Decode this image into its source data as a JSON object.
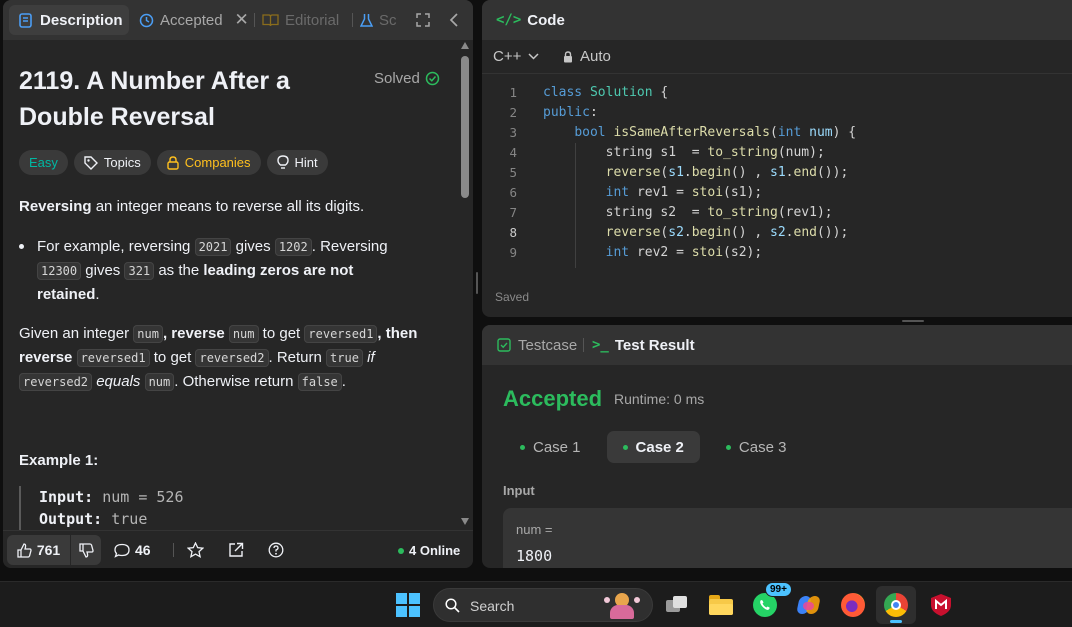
{
  "left_tabs": {
    "description": "Description",
    "accepted": "Accepted",
    "editorial": "Editorial",
    "solutions": "Sc"
  },
  "problem": {
    "title_line1": "2119. A Number After a",
    "title_line2": "Double Reversal",
    "solved": "Solved",
    "tags": {
      "easy": "Easy",
      "topics": "Topics",
      "companies": "Companies",
      "hint": "Hint"
    },
    "p1_bold": "Reversing",
    "p1_rest": " an integer means to reverse all its digits.",
    "bullet": {
      "t1": "For example, reversing ",
      "c1": "2021",
      "t2": " gives ",
      "c2": "1202",
      "t3": ". Reversing",
      "c3": "12300",
      "t4": " gives ",
      "c4": "321",
      "t5": " as the ",
      "b1": "leading zeros are not",
      "b2": "retained",
      "t6": "."
    },
    "p2": {
      "t1": "Given an integer ",
      "c1": "num",
      "b1": ", reverse ",
      "c2": "num",
      "t2": " to get ",
      "c3": "reversed1",
      "b2": ", then",
      "b3": "reverse ",
      "c4": "reversed1",
      "t3": " to get ",
      "c5": "reversed2",
      "t4": ". Return ",
      "c6": "true",
      "i1": " if",
      "c7": "reversed2",
      "i2": " equals ",
      "c8": "num",
      "t5": ". Otherwise return ",
      "c9": "false",
      "t6": "."
    },
    "example_title": "Example 1:",
    "ex_input_label": "Input:",
    "ex_input_value": " num = 526",
    "ex_output_label": "Output:",
    "ex_output_value": " true"
  },
  "footer": {
    "likes": "761",
    "comments": "46",
    "online": "4 Online"
  },
  "code": {
    "title": "Code",
    "language": "C++",
    "auto": "Auto",
    "saved": "Saved",
    "lines": [
      {
        "n": "1",
        "tokens": [
          [
            "kw",
            "class "
          ],
          [
            "ty",
            "Solution"
          ],
          [
            "pl",
            " {"
          ]
        ]
      },
      {
        "n": "2",
        "tokens": [
          [
            "kw",
            "public"
          ],
          [
            "pl",
            ":"
          ]
        ]
      },
      {
        "n": "3",
        "tokens": [
          [
            "pl",
            "    "
          ],
          [
            "kw",
            "bool "
          ],
          [
            "fn",
            "isSameAfterReversals"
          ],
          [
            "pl",
            "("
          ],
          [
            "kw",
            "int "
          ],
          [
            "var",
            "num"
          ],
          [
            "pl",
            ") {"
          ]
        ]
      },
      {
        "n": "4",
        "tokens": [
          [
            "pl",
            "        string s1  = "
          ],
          [
            "fn",
            "to_string"
          ],
          [
            "pl",
            "(num);"
          ]
        ]
      },
      {
        "n": "5",
        "tokens": [
          [
            "pl",
            "        "
          ],
          [
            "fn",
            "reverse"
          ],
          [
            "pl",
            "("
          ],
          [
            "var",
            "s1"
          ],
          [
            "pl",
            "."
          ],
          [
            "fn",
            "begin"
          ],
          [
            "pl",
            "() , "
          ],
          [
            "var",
            "s1"
          ],
          [
            "pl",
            "."
          ],
          [
            "fn",
            "end"
          ],
          [
            "pl",
            "());"
          ]
        ]
      },
      {
        "n": "6",
        "tokens": [
          [
            "pl",
            "        "
          ],
          [
            "kw",
            "int "
          ],
          [
            "pl",
            "rev1 = "
          ],
          [
            "fn",
            "stoi"
          ],
          [
            "pl",
            "(s1);"
          ]
        ]
      },
      {
        "n": "7",
        "tokens": [
          [
            "pl",
            "        string s2  = "
          ],
          [
            "fn",
            "to_string"
          ],
          [
            "pl",
            "(rev1);"
          ]
        ]
      },
      {
        "n": "8",
        "tokens": [
          [
            "pl",
            "        "
          ],
          [
            "fn",
            "reverse"
          ],
          [
            "pl",
            "("
          ],
          [
            "var",
            "s2"
          ],
          [
            "pl",
            "."
          ],
          [
            "fn",
            "begin"
          ],
          [
            "pl",
            "() , "
          ],
          [
            "var",
            "s2"
          ],
          [
            "pl",
            "."
          ],
          [
            "fn",
            "end"
          ],
          [
            "pl",
            "());"
          ]
        ]
      },
      {
        "n": "9",
        "tokens": [
          [
            "pl",
            "        "
          ],
          [
            "kw",
            "int "
          ],
          [
            "pl",
            "rev2 = "
          ],
          [
            "fn",
            "stoi"
          ],
          [
            "pl",
            "(s2);"
          ]
        ]
      }
    ]
  },
  "result": {
    "tab_testcase": "Testcase",
    "tab_result": "Test Result",
    "status": "Accepted",
    "runtime": "Runtime: 0 ms",
    "cases": [
      "Case 1",
      "Case 2",
      "Case 3"
    ],
    "input_label": "Input",
    "var_label": "num =",
    "var_value": "1800"
  },
  "taskbar": {
    "search": "Search",
    "badge": "99+"
  },
  "colors": {
    "accent_green": "#2cbb5d",
    "easy": "#00b8a3",
    "companies": "#ffc01e"
  }
}
